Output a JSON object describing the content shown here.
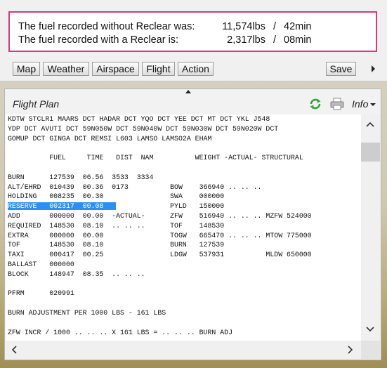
{
  "notice": {
    "row1": {
      "label": "The fuel recorded without Reclear was:",
      "fuel": "11,574lbs",
      "sep": "/",
      "time": "42min"
    },
    "row2": {
      "label": "The fuel recorded with a Reclear is:",
      "fuel": "2,317lbs",
      "sep": "/",
      "time": "08min"
    }
  },
  "toolbar": {
    "map": "Map",
    "weather": "Weather",
    "airspace": "Airspace",
    "flight": "Flight",
    "action": "Action",
    "save": "Save"
  },
  "flight_plan": {
    "title": "Flight Plan",
    "info_label": "Info",
    "lines": [
      "KDTW STCLR1 MAARS DCT HADAR DCT YQO DCT YEE DCT MT DCT YKL J548",
      "YDP DCT AVUTI DCT 59N050W DCT 59N040W DCT 59N030W DCT 59N020W DCT",
      "GOMUP DCT GINGA DCT REMSI L603 LAMSO LAMSO2A EHAM",
      "",
      "          FUEL     TIME   DIST  NAM          WEIGHT -ACTUAL- STRUCTURAL",
      "",
      "BURN      127539  06.56  3533  3334",
      "ALT/EHRD  010439  00.36  0173          BOW    366940 .. .. ..",
      "HOLDING   008235  00.30                SWA    000000",
      "RESERVE   002317  00.08                PYLD   150000",
      "ADD       000000  00.00  -ACTUAL-      ZFW    516940 .. .. .. MZFW 524000",
      "REQUIRED  148530  08.10  .. .. ..      TOF    148530",
      "EXTRA     000000  00.00                TOGW   665470 .. .. .. MTOW 775000",
      "TOF       148530  08.10                BURN   127539",
      "TAXI      000417  00.25                LDGW   537931          MLDW 650000",
      "BALLAST   000000",
      "BLOCK     148947  08.35  .. .. ..",
      "",
      "PFRM      020991",
      "",
      "BURN ADJUSTMENT PER 1000 LBS - 161 LBS",
      "",
      "ZFW INCR / 1000 .. .. .. X 161 LBS = .. .. .. BURN ADJ"
    ],
    "highlighted_line_index": 9,
    "highlighted_chars": 26,
    "icons": {
      "refresh": "refresh-icon",
      "print": "printer-icon"
    },
    "accent_color": "#2f8ff0"
  }
}
